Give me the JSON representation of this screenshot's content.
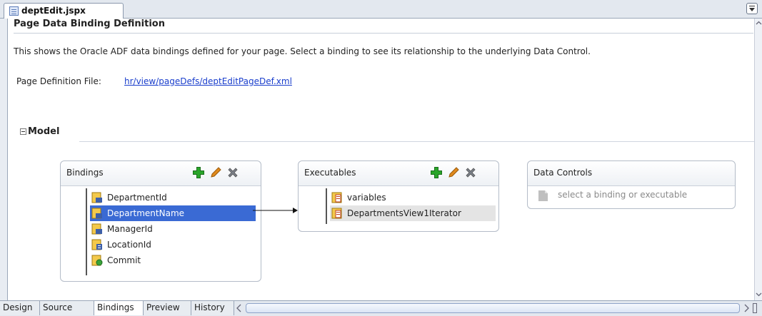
{
  "editor": {
    "file_tab": "deptEdit.jspx"
  },
  "header": {
    "title": "Page Data Binding Definition",
    "description": "This shows the Oracle ADF data bindings defined for your page. Select a binding to see its relationship to the underlying Data Control.",
    "page_def_label": "Page Definition File:",
    "page_def_link": "hr/view/pageDefs/deptEditPageDef.xml"
  },
  "model": {
    "label": "Model"
  },
  "bindings": {
    "title": "Bindings",
    "items": [
      {
        "label": "DepartmentId",
        "icon": "attribute-binding-icon"
      },
      {
        "label": "DepartmentName",
        "icon": "attribute-binding-icon",
        "selected": true
      },
      {
        "label": "ManagerId",
        "icon": "attribute-binding-icon"
      },
      {
        "label": "LocationId",
        "icon": "list-binding-icon"
      },
      {
        "label": "Commit",
        "icon": "action-binding-icon"
      }
    ]
  },
  "executables": {
    "title": "Executables",
    "items": [
      {
        "label": "variables",
        "icon": "variables-icon"
      },
      {
        "label": "DepartmentsView1Iterator",
        "icon": "iterator-icon",
        "highlighted": true
      }
    ]
  },
  "data_controls": {
    "title": "Data Controls",
    "placeholder": "select a binding or executable"
  },
  "bottom_tabs": [
    {
      "label": "Design"
    },
    {
      "label": "Source"
    },
    {
      "label": "Bindings",
      "active": true
    },
    {
      "label": "Preview"
    },
    {
      "label": "History"
    }
  ],
  "colors": {
    "selection": "#3a6ad4",
    "link": "#1a3ecc",
    "add_green": "#2aa52a",
    "edit_orange": "#e08a1e",
    "delete_gray": "#7a7f88"
  }
}
